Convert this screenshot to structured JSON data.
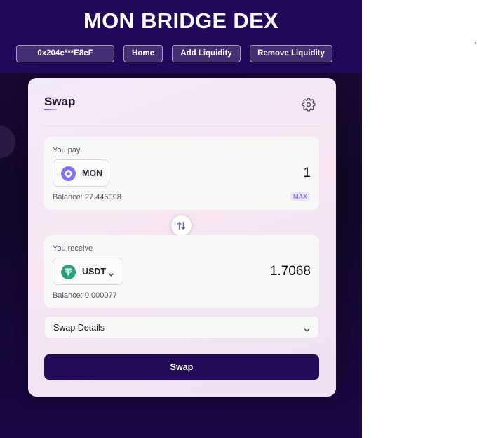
{
  "header": {
    "title": "MON BRIDGE DEX",
    "wallet_label": "0x204e***E8eF",
    "nav": {
      "home": "Home",
      "add_liquidity": "Add Liquidity",
      "remove_liquidity": "Remove Liquidity"
    }
  },
  "swap": {
    "tab_title": "Swap",
    "pay": {
      "label": "You pay",
      "token": "MON",
      "amount": "1",
      "balance": "Balance: 27.445098",
      "max_label": "MAX"
    },
    "receive": {
      "label": "You receive",
      "token": "USDT",
      "amount": "1.7068",
      "balance": "Balance: 0.000077"
    },
    "details_label": "Swap Details",
    "swap_button": "Swap"
  },
  "icons": {
    "settings": "gear-icon",
    "mon_token": "mon-token-icon",
    "usdt_token": "usdt-token-icon",
    "switch": "swap-arrows-icon",
    "chevron": "chevron-down-icon"
  },
  "colors": {
    "header_bg": "#21085a",
    "accent": "#240a58",
    "mon": "#836ef9",
    "usdt": "#26a17b"
  }
}
